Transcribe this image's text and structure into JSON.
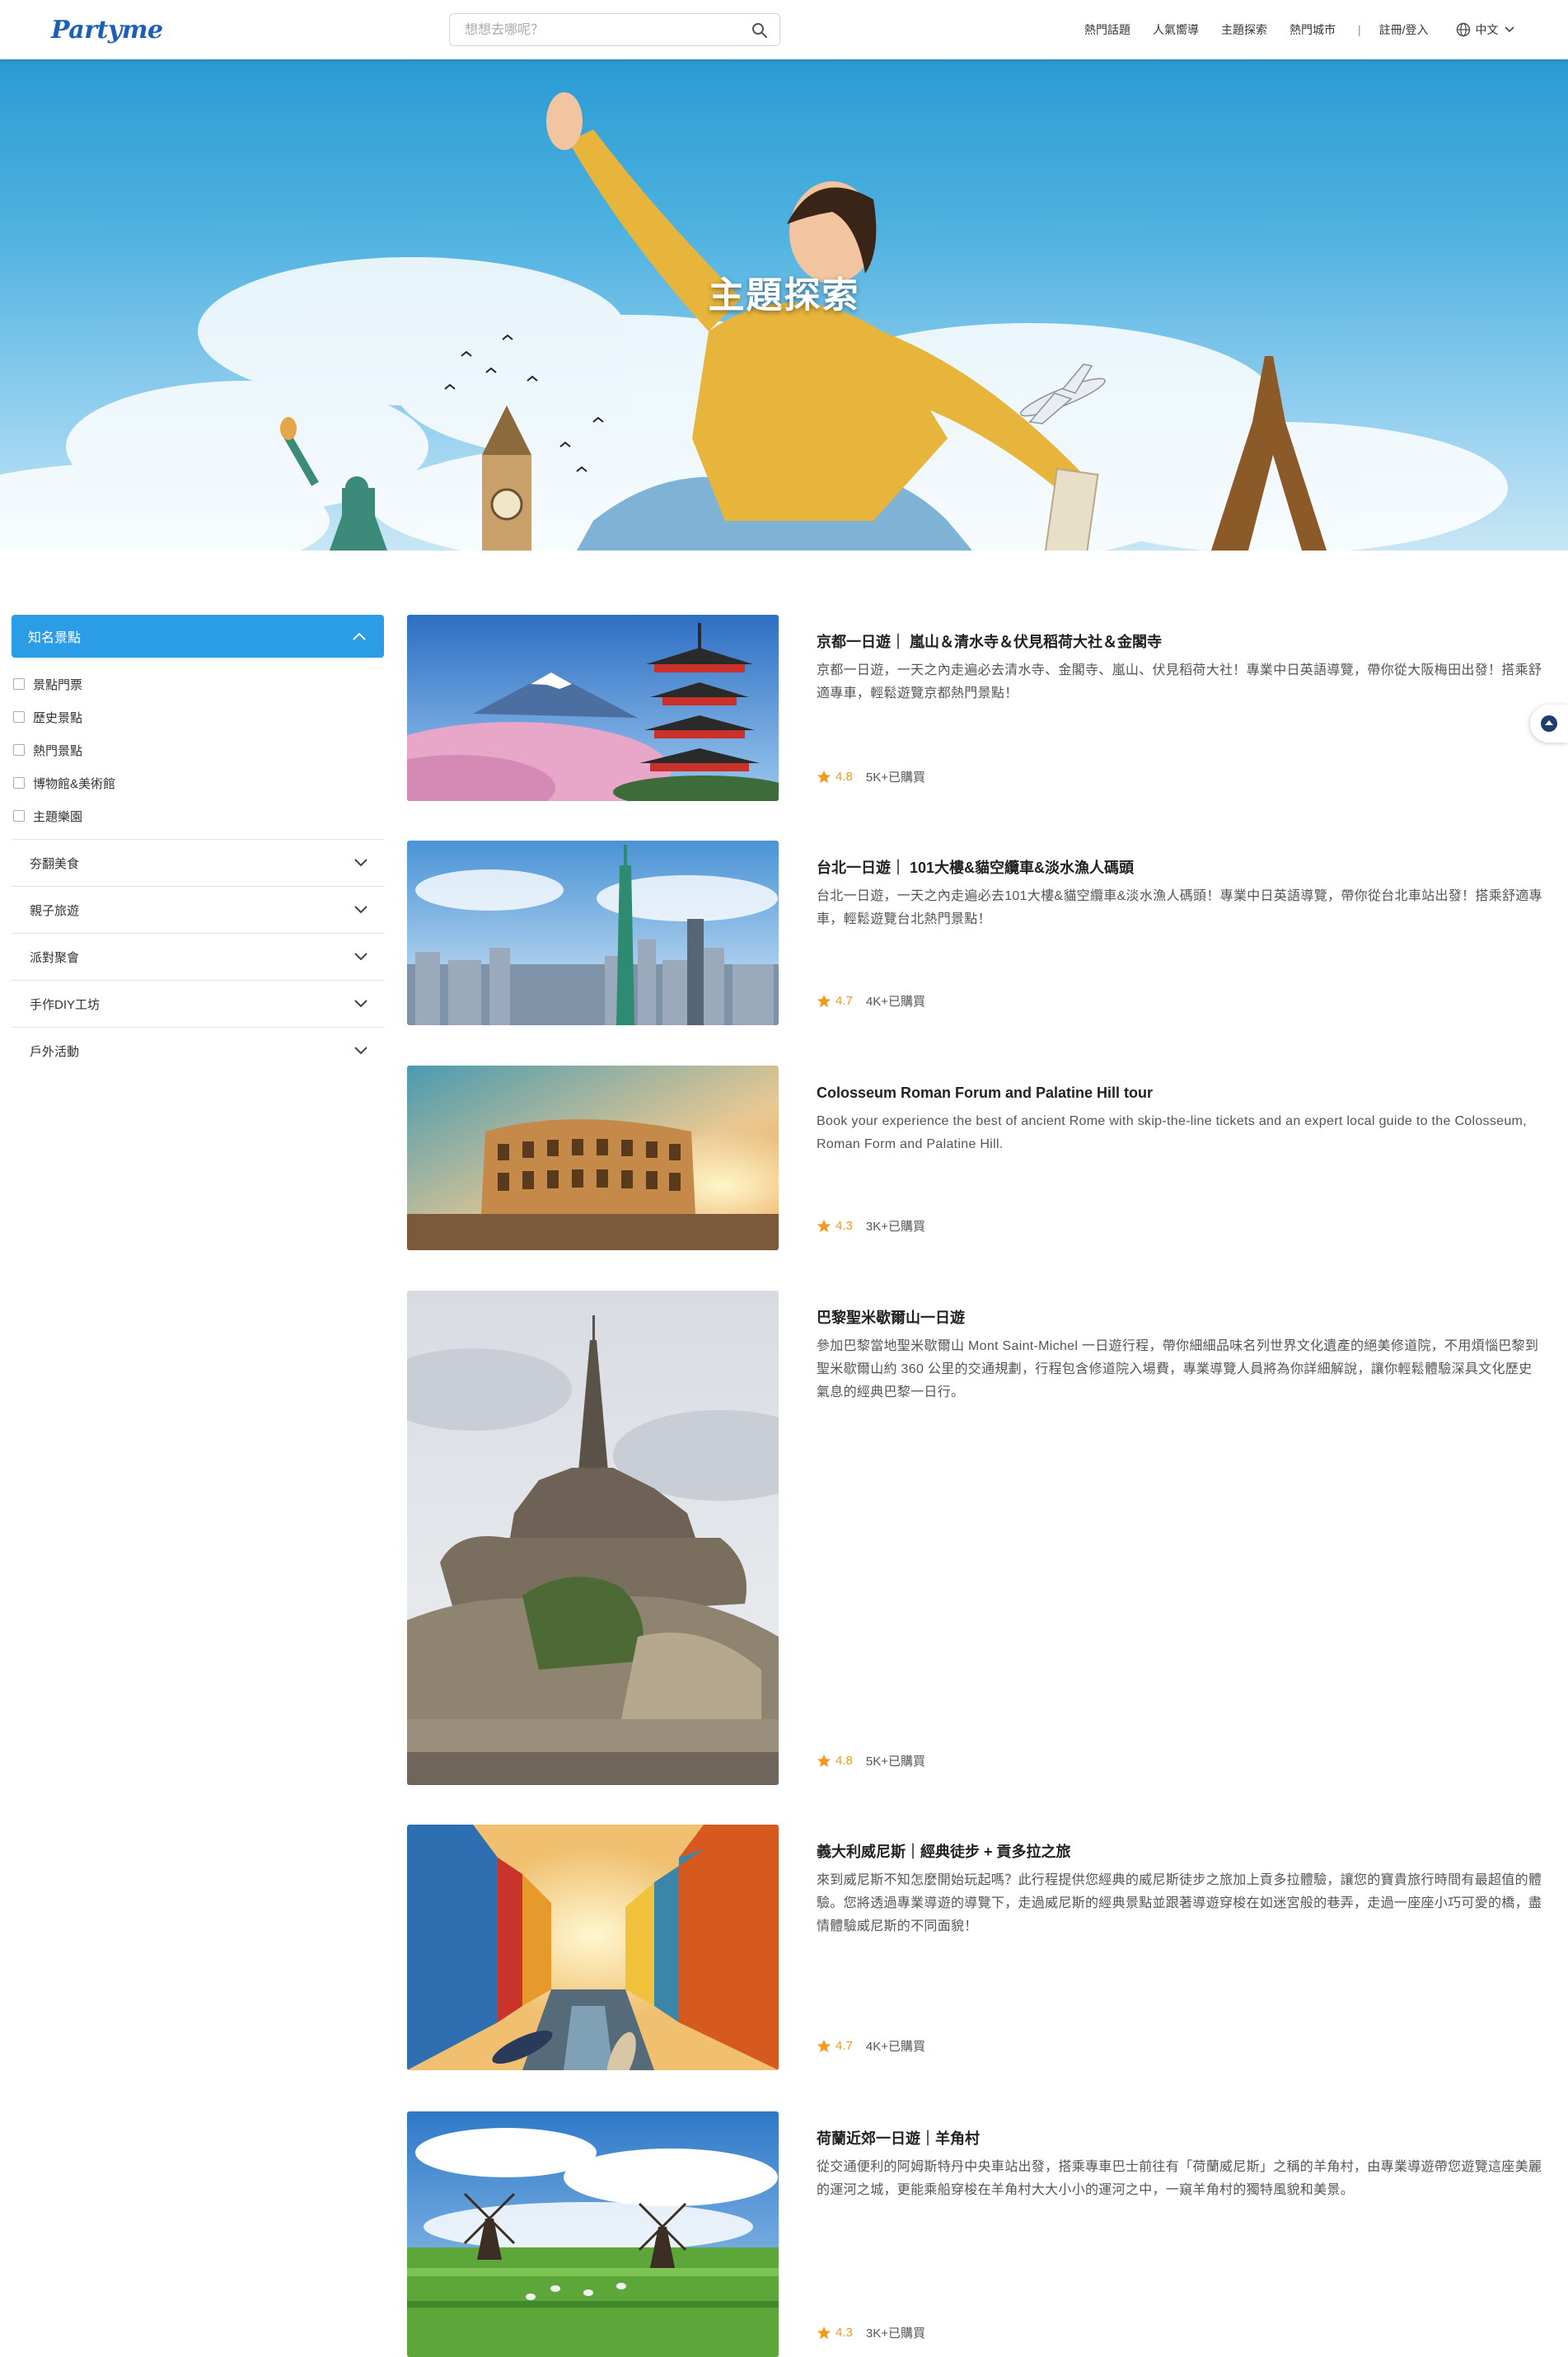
{
  "header": {
    "logo": "Partyme",
    "search_placeholder": "想想去哪呢？",
    "nav": [
      "熱門話題",
      "人氣嚮導",
      "主題探索",
      "熱門城市"
    ],
    "nav_separator": "|",
    "login": "註冊/登入",
    "language": "中文"
  },
  "hero": {
    "title": "主題探索"
  },
  "sidebar": {
    "open_category": "知名景點",
    "sub_items": [
      "景點門票",
      "歷史景點",
      "熱門景點",
      "博物館&美術館",
      "主題樂園"
    ],
    "categories": [
      "夯翻美食",
      "親子旅遊",
      "派對聚會",
      "手作DIY工坊",
      "戶外活動"
    ]
  },
  "listings": [
    {
      "title": "京都一日遊｜ 嵐山＆清水寺＆伏見稻荷大社＆金閣寺",
      "desc": "京都一日遊，一天之內走遍必去清水寺、金閣寺、嵐山、伏見稻荷大社！專業中日英語導覽，帶你從大阪梅田出發！搭乘舒適專車，輕鬆遊覽京都熱門景點！",
      "rating": "4.8",
      "bought": "5K+已購買",
      "image_icon": "kyoto-pagoda-image"
    },
    {
      "title": "台北一日遊｜ 101大樓&貓空纜車&淡水漁人碼頭",
      "desc": "台北一日遊，一天之內走遍必去101大樓&貓空纜車&淡水漁人碼頭！專業中日英語導覽，帶你從台北車站出發！搭乘舒適專車，輕鬆遊覽台北熱門景點！",
      "rating": "4.7",
      "bought": "4K+已購買",
      "image_icon": "taipei-skyline-image"
    },
    {
      "title": "Colosseum Roman Forum and Palatine Hill tour",
      "desc": "Book your experience the best of ancient Rome with skip-the-line tickets and an expert local guide to the Colosseum, Roman Form and Palatine Hill.",
      "rating": "4.3",
      "bought": "3K+已購買",
      "image_icon": "colosseum-image"
    },
    {
      "title": "巴黎聖米歇爾山一日遊",
      "desc": "參加巴黎當地聖米歇爾山 Mont Saint-Michel 一日遊行程，帶你細細品味名列世界文化遺產的絕美修道院，不用煩惱巴黎到聖米歇爾山約 360 公里的交通規劃，行程包含修道院入場費，專業導覽人員將為你詳細解說，讓你輕鬆體驗深具文化歷史氣息的經典巴黎一日行。",
      "rating": "4.8",
      "bought": "5K+已購買",
      "image_icon": "mont-saint-michel-image"
    },
    {
      "title": "義大利威尼斯｜經典徒步 + 貢多拉之旅",
      "desc": "來到威尼斯不知怎麼開始玩起嗎？此行程提供您經典的威尼斯徒步之旅加上貢多拉體驗，讓您的寶貴旅行時間有最超值的體驗。您將透過專業導遊的導覽下，走過威尼斯的經典景點並跟著導遊穿梭在如迷宮般的巷弄，走過一座座小巧可愛的橋，盡情體驗威尼斯的不同面貌！",
      "rating": "4.7",
      "bought": "4K+已購買",
      "image_icon": "venice-canal-image"
    },
    {
      "title": "荷蘭近郊一日遊｜羊角村",
      "desc": "從交通便利的阿姆斯特丹中央車站出發，搭乘專車巴士前往有「荷蘭威尼斯」之稱的羊角村，由專業導遊帶您遊覽這座美麗的運河之城，更能乘船穿梭在羊角村大大小小的運河之中，一窺羊角村的獨特風貌和美景。",
      "rating": "4.3",
      "bought": "3K+已購買",
      "image_icon": "dutch-windmill-image"
    }
  ],
  "colors": {
    "brand_blue": "#1d5fb8",
    "accent_blue": "#2b9ce6",
    "rating_orange": "#f19a1c"
  }
}
